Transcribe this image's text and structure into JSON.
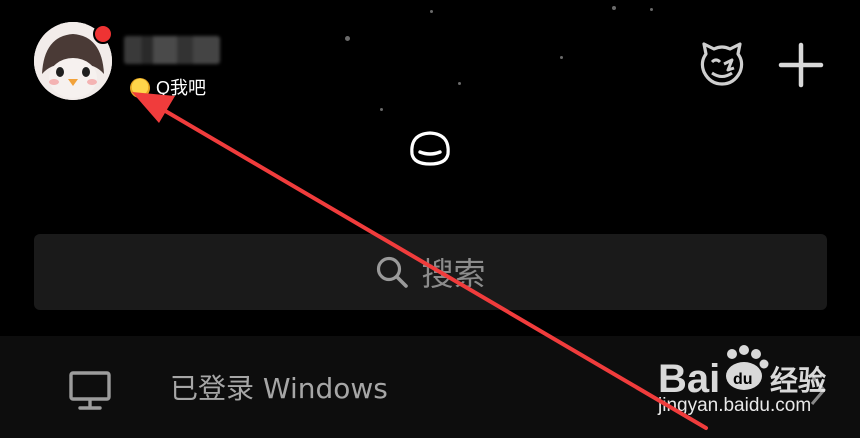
{
  "header": {
    "status_text": "Q我吧",
    "status_emoji_icon": "yellow-face-emoji-icon",
    "nickname_note": ""
  },
  "icons": {
    "avatar": "penguin-avatar",
    "face": "pet-face-icon",
    "plus": "plus-icon",
    "center": "pull-down-smile-icon",
    "search": "search-icon",
    "monitor": "monitor-icon",
    "chevron": "chevron-right-icon"
  },
  "search": {
    "label": "搜索"
  },
  "device": {
    "label": "已登录 Windows"
  },
  "watermark": {
    "brand": "Bai 经验",
    "site": "jingyan.baidu.com"
  },
  "colors": {
    "background": "#000000",
    "search_bg": "#1a1a1a",
    "badge": "#ee3333",
    "arrow": "#f03c3c"
  }
}
